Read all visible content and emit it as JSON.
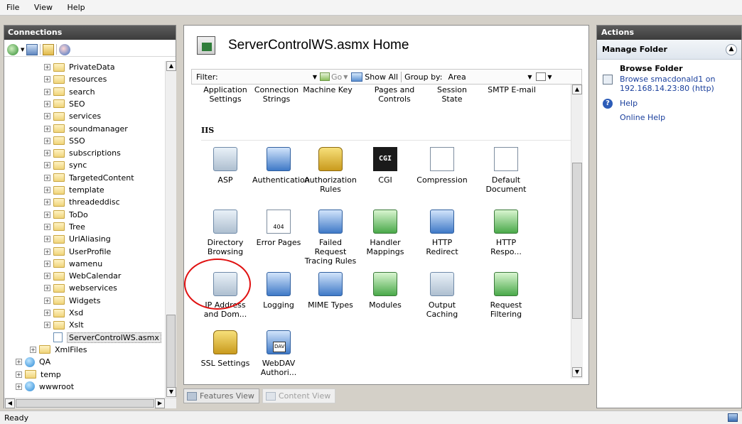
{
  "menu": [
    "File",
    "View",
    "Help"
  ],
  "connections": {
    "header": "Connections",
    "tree": [
      {
        "label": "PrivateData",
        "kind": "folder",
        "level": 2
      },
      {
        "label": "resources",
        "kind": "folder",
        "level": 2
      },
      {
        "label": "search",
        "kind": "folder",
        "level": 2
      },
      {
        "label": "SEO",
        "kind": "folder",
        "level": 2
      },
      {
        "label": "services",
        "kind": "folder",
        "level": 2
      },
      {
        "label": "soundmanager",
        "kind": "folder",
        "level": 2
      },
      {
        "label": "SSO",
        "kind": "folder",
        "level": 2
      },
      {
        "label": "subscriptions",
        "kind": "folder",
        "level": 2
      },
      {
        "label": "sync",
        "kind": "folder",
        "level": 2
      },
      {
        "label": "TargetedContent",
        "kind": "folder",
        "level": 2
      },
      {
        "label": "template",
        "kind": "folder",
        "level": 2
      },
      {
        "label": "threadeddisc",
        "kind": "folder",
        "level": 2
      },
      {
        "label": "ToDo",
        "kind": "folder",
        "level": 2
      },
      {
        "label": "Tree",
        "kind": "folder",
        "level": 2
      },
      {
        "label": "UrlAliasing",
        "kind": "folder",
        "level": 2
      },
      {
        "label": "UserProfile",
        "kind": "folder",
        "level": 2
      },
      {
        "label": "wamenu",
        "kind": "folder",
        "level": 2
      },
      {
        "label": "WebCalendar",
        "kind": "folder",
        "level": 2
      },
      {
        "label": "webservices",
        "kind": "folder",
        "level": 2
      },
      {
        "label": "Widgets",
        "kind": "folder",
        "level": 2
      },
      {
        "label": "Xsd",
        "kind": "folder",
        "level": 2
      },
      {
        "label": "Xslt",
        "kind": "folder",
        "level": 2
      },
      {
        "label": "ServerControlWS.asmx",
        "kind": "page",
        "level": 2,
        "selected": true
      },
      {
        "label": "XmlFiles",
        "kind": "folder",
        "level": 1
      },
      {
        "label": "QA",
        "kind": "globe",
        "level": 0
      },
      {
        "label": "temp",
        "kind": "folder",
        "level": 0
      },
      {
        "label": "wwwroot",
        "kind": "globe",
        "level": 0
      }
    ]
  },
  "home": {
    "title": "ServerControlWS.asmx Home",
    "filter_label": "Filter:",
    "filter_value": "",
    "go_label": "Go",
    "show_all_label": "Show All",
    "group_by_label": "Group by:",
    "group_by_value": "Area"
  },
  "features": {
    "top_row": [
      "Application Settings",
      "Connection Strings",
      "Machine Key",
      "Pages and Controls",
      "Session State",
      "SMTP E-mail"
    ],
    "iis_group": "IIS",
    "items": [
      {
        "label": "ASP",
        "icon": "asp-icon"
      },
      {
        "label": "Authentication",
        "icon": "authentication-icon"
      },
      {
        "label": "Authorization Rules",
        "icon": "authorization-rules-icon"
      },
      {
        "label": "CGI",
        "icon": "cgi-icon"
      },
      {
        "label": "Compression",
        "icon": "compression-icon"
      },
      {
        "label": "Default Document",
        "icon": "default-document-icon"
      },
      {
        "label": "Directory Browsing",
        "icon": "directory-browsing-icon"
      },
      {
        "label": "Error Pages",
        "icon": "error-pages-icon"
      },
      {
        "label": "Failed Request Tracing Rules",
        "icon": "failed-request-tracing-icon"
      },
      {
        "label": "Handler Mappings",
        "icon": "handler-mappings-icon"
      },
      {
        "label": "HTTP Redirect",
        "icon": "http-redirect-icon"
      },
      {
        "label": "HTTP Respo...",
        "icon": "http-response-headers-icon"
      },
      {
        "label": "IP Address and Dom...",
        "icon": "ip-address-domain-icon"
      },
      {
        "label": "Logging",
        "icon": "logging-icon"
      },
      {
        "label": "MIME Types",
        "icon": "mime-types-icon"
      },
      {
        "label": "Modules",
        "icon": "modules-icon"
      },
      {
        "label": "Output Caching",
        "icon": "output-caching-icon"
      },
      {
        "label": "Request Filtering",
        "icon": "request-filtering-icon"
      },
      {
        "label": "SSL Settings",
        "icon": "ssl-settings-icon"
      },
      {
        "label": "WebDAV Authori...",
        "icon": "webdav-authoring-icon"
      }
    ],
    "cgi_icon_text": "CGI",
    "error_icon_text": "404",
    "dav_icon_text": "DAV"
  },
  "views": {
    "features_view": "Features View",
    "content_view": "Content View"
  },
  "actions": {
    "header": "Actions",
    "section": "Manage Folder",
    "browse_title": "Browse Folder",
    "browse_link": "Browse smacdonald1 on 192.168.14.23:80 (http)",
    "help": "Help",
    "online_help": "Online Help"
  },
  "status": {
    "text": "Ready"
  }
}
